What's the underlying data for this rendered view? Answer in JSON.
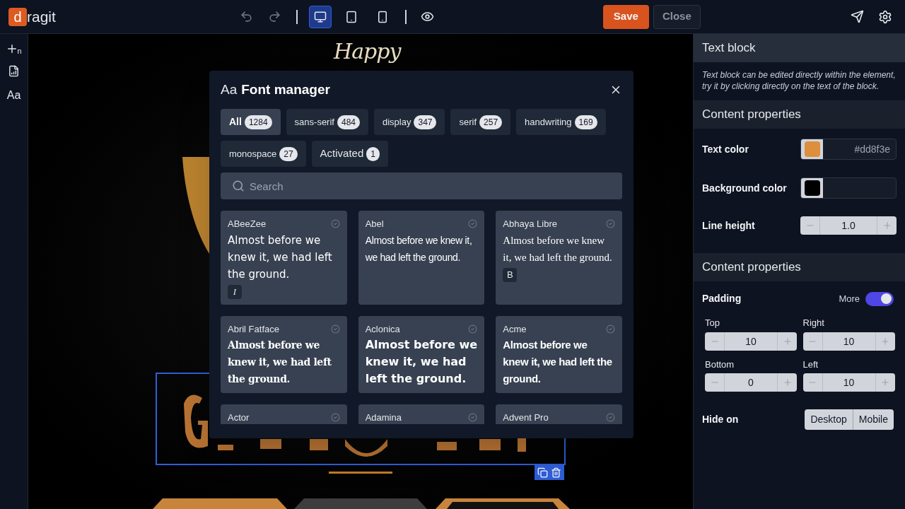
{
  "logo": {
    "mark": "d",
    "text": "ragit"
  },
  "toolbar": {
    "history": [
      {
        "kind": "undo",
        "disabled": true
      },
      {
        "kind": "redo",
        "disabled": true
      }
    ],
    "devices": [
      {
        "kind": "desktop",
        "selected": true
      },
      {
        "kind": "tablet",
        "selected": false
      },
      {
        "kind": "mobile",
        "selected": false
      }
    ],
    "save": "Save",
    "close": "Close"
  },
  "sidebar": {
    "add_subscript": "n",
    "fonts_label": "Aa"
  },
  "canvas": {
    "script_text": "Happy"
  },
  "font_manager": {
    "icon_text": "Aa",
    "title": "Font manager",
    "filters": [
      {
        "label": "All",
        "count": "1284",
        "selected": true
      },
      {
        "label": "sans-serif",
        "count": "484",
        "selected": false
      },
      {
        "label": "display",
        "count": "347",
        "selected": false
      },
      {
        "label": "serif",
        "count": "257",
        "selected": false
      },
      {
        "label": "handwriting",
        "count": "169",
        "selected": false
      },
      {
        "label": "monospace",
        "count": "27",
        "selected": false
      },
      {
        "label": "Activated",
        "count": "1",
        "selected": false
      }
    ],
    "search": {
      "placeholder": "Search"
    },
    "fonts": [
      {
        "name": "ABeeZee",
        "kind": "rounded",
        "sample": "Almost before we knew it, we had left the ground.",
        "badge": "I"
      },
      {
        "name": "Abel",
        "kind": "condensed",
        "sample": "Almost before we knew it, we had left the ground."
      },
      {
        "name": "Abhaya Libre",
        "kind": "serif",
        "sample": "Almost before we knew it, we had left the ground.",
        "badge": "B"
      },
      {
        "name": "Abril Fatface",
        "kind": "fatface",
        "sample": "Almost before we knew it, we had left the ground."
      },
      {
        "name": "Aclonica",
        "kind": "display",
        "sample": "Almost before we knew it, we had left the ground."
      },
      {
        "name": "Acme",
        "kind": "heavy",
        "sample": "Almost before we knew it, we had left the ground."
      },
      {
        "name": "Actor"
      },
      {
        "name": "Adamina"
      },
      {
        "name": "Advent Pro"
      }
    ]
  },
  "panel": {
    "title": "Text block",
    "description": "Text block can be edited directly within the element, try it by clicking directly on the text of the block.",
    "content": {
      "title": "Content properties",
      "text_color": {
        "label": "Text color",
        "color": "#dd8f3e",
        "value": "#dd8f3e"
      },
      "background_color": {
        "label": "Background color",
        "color": "#000000"
      },
      "line_height": {
        "label": "Line height",
        "value": "1.0"
      }
    },
    "layout": {
      "title": "Content properties",
      "padding": {
        "label": "Padding",
        "more": {
          "label": "More",
          "on": true
        },
        "fields": [
          {
            "label": "Top",
            "value": "10"
          },
          {
            "label": "Right",
            "value": "10"
          },
          {
            "label": "Bottom",
            "value": "0"
          },
          {
            "label": "Left",
            "value": "10"
          }
        ]
      },
      "hide_on": {
        "label": "Hide on",
        "options": [
          "Desktop",
          "Mobile"
        ]
      }
    }
  }
}
